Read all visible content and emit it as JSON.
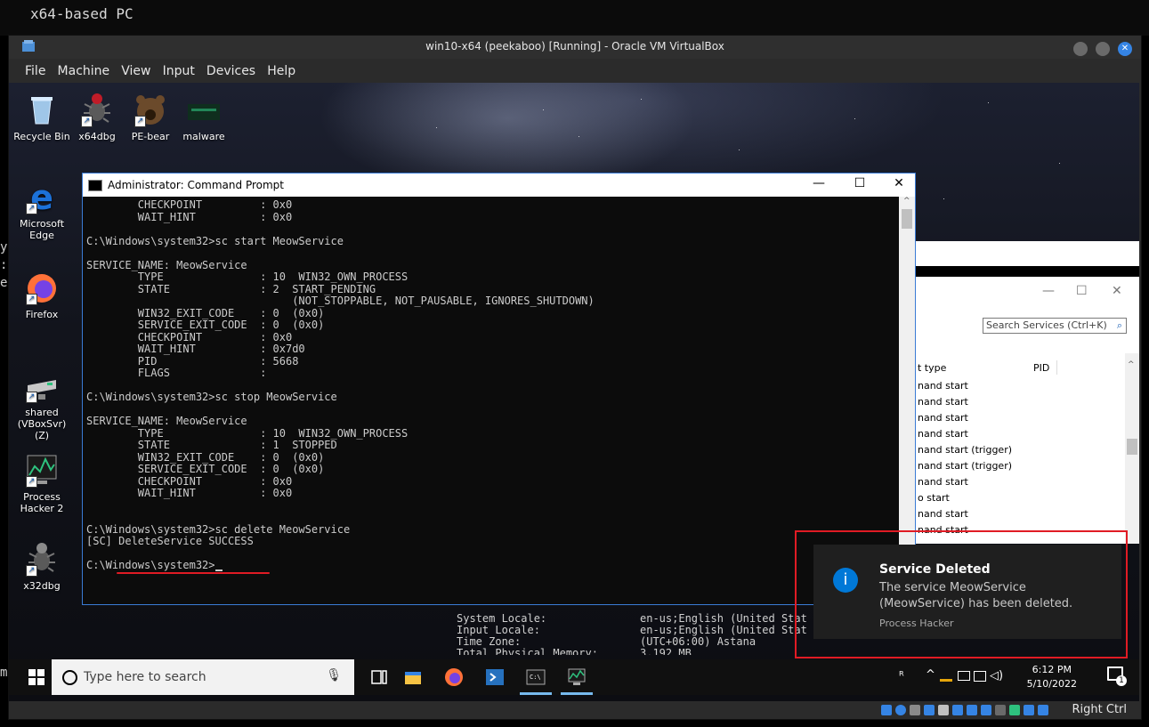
{
  "host": {
    "terminal_lines": [
      "x64-based PC"
    ],
    "side_fragments": [
      "y",
      ":",
      "e",
      "m:"
    ]
  },
  "vbox": {
    "title": "win10-x64 (peekaboo) [Running] - Oracle VM VirtualBox",
    "menu": [
      "File",
      "Machine",
      "View",
      "Input",
      "Devices",
      "Help"
    ],
    "host_key": "Right Ctrl"
  },
  "desktop_icons": [
    {
      "label": "Recycle Bin",
      "icon": "recycle-bin-icon"
    },
    {
      "label": "x64dbg",
      "icon": "bug-icon"
    },
    {
      "label": "PE-bear",
      "icon": "bear-icon"
    },
    {
      "label": "malware",
      "icon": "folder-icon"
    },
    {
      "label": "Microsoft Edge",
      "icon": "edge-icon"
    },
    {
      "label": "Firefox",
      "icon": "firefox-icon"
    },
    {
      "label": "shared (VBoxSvr) (Z)",
      "icon": "network-drive-icon"
    },
    {
      "label": "Process Hacker 2",
      "icon": "process-hacker-icon"
    },
    {
      "label": "x32dbg",
      "icon": "bug-icon"
    }
  ],
  "cmd": {
    "title": "Administrator: Command Prompt",
    "controls": [
      "—",
      "☐",
      "✕"
    ],
    "lines": [
      "        CHECKPOINT         : 0x0",
      "        WAIT_HINT          : 0x0",
      "",
      "C:\\Windows\\system32>sc start MeowService",
      "",
      "SERVICE_NAME: MeowService",
      "        TYPE               : 10  WIN32_OWN_PROCESS",
      "        STATE              : 2  START_PENDING",
      "                                (NOT_STOPPABLE, NOT_PAUSABLE, IGNORES_SHUTDOWN)",
      "        WIN32_EXIT_CODE    : 0  (0x0)",
      "        SERVICE_EXIT_CODE  : 0  (0x0)",
      "        CHECKPOINT         : 0x0",
      "        WAIT_HINT          : 0x7d0",
      "        PID                : 5668",
      "        FLAGS              :",
      "",
      "C:\\Windows\\system32>sc stop MeowService",
      "",
      "SERVICE_NAME: MeowService",
      "        TYPE               : 10  WIN32_OWN_PROCESS",
      "        STATE              : 1  STOPPED",
      "        WIN32_EXIT_CODE    : 0  (0x0)",
      "        SERVICE_EXIT_CODE  : 0  (0x0)",
      "        CHECKPOINT         : 0x0",
      "        WAIT_HINT          : 0x0",
      "",
      "",
      "C:\\Windows\\system32>sc delete MeowService",
      "[SC] DeleteService SUCCESS",
      "",
      "C:\\Windows\\system32>"
    ]
  },
  "background_sysinfo": [
    {
      "label": "System Locale:",
      "value": "en-us;English (United Stat"
    },
    {
      "label": "Input Locale:",
      "value": "en-us;English (United Stat"
    },
    {
      "label": "Time Zone:",
      "value": "(UTC+06:00) Astana"
    },
    {
      "label": "Total Physical Memory:",
      "value": "3,192 MB"
    }
  ],
  "services": {
    "controls": [
      "—",
      "☐",
      "✕"
    ],
    "search_placeholder": "Search Services (Ctrl+K)",
    "columns": [
      "t type",
      "PID"
    ],
    "rows": [
      "nand start",
      "nand start",
      "nand start",
      "nand start",
      "nand start (trigger)",
      "nand start (trigger)",
      "nand start",
      "o start",
      "nand start",
      "nand start"
    ]
  },
  "notification": {
    "title": "Service Deleted",
    "text": "The service MeowService (MeowService) has been deleted.",
    "source": "Process Hacker"
  },
  "taskbar": {
    "search_placeholder": "Type here to search",
    "time": "6:12 PM",
    "date": "5/10/2022",
    "notification_count": "1"
  }
}
